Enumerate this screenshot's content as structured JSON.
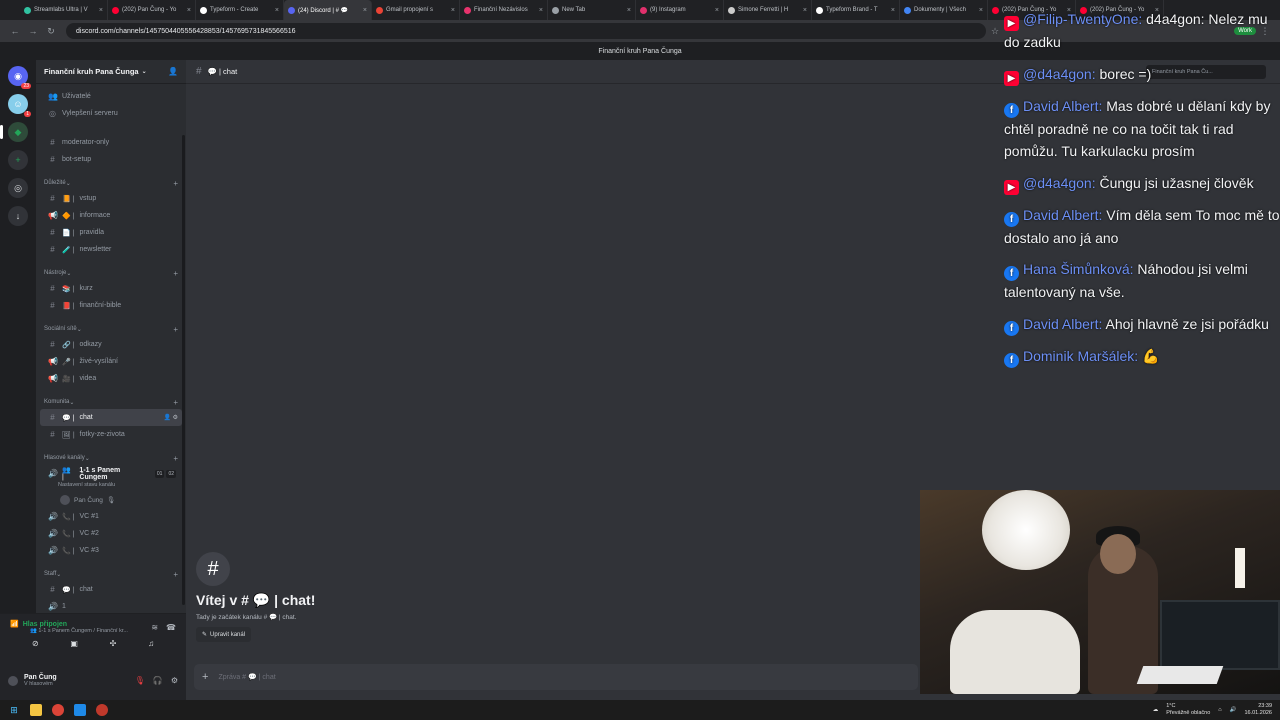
{
  "browser": {
    "tabs": [
      {
        "label": "Streamlabs Ultra | V",
        "color": "#31c3a2"
      },
      {
        "label": "(202) Pan Čung - Yo",
        "color": "#ff0033"
      },
      {
        "label": "Typeform - Create",
        "color": "#ffffff"
      },
      {
        "label": "(24) Discord | # 💬",
        "color": "#5865f2",
        "active": true
      },
      {
        "label": "Gmail propojení s",
        "color": "#ea4335"
      },
      {
        "label": "Finanční Nezávislos",
        "color": "#e8336d"
      },
      {
        "label": "New Tab",
        "color": "#9aa0a6"
      },
      {
        "label": "(9) Instagram",
        "color": "#e1306c"
      },
      {
        "label": "Simone Ferretti | H",
        "color": "#cccccc"
      },
      {
        "label": "Typeform Brand - T",
        "color": "#ffffff"
      },
      {
        "label": "Dokumenty | Všech",
        "color": "#4285f4"
      },
      {
        "label": "(202) Pan Čung - Yo",
        "color": "#ff0033"
      },
      {
        "label": "(202) Pan Čung - Yo",
        "color": "#ff0033"
      }
    ],
    "url": "discord.com/channels/1457504405556428853/1457695731845566516",
    "profile_label": "Work"
  },
  "discord": {
    "window_title": "Finanční kruh Pana Čunga",
    "rail_badges": [
      "23",
      "1"
    ],
    "server_name": "Finanční kruh Pana Čunga",
    "top_items": [
      {
        "icon": "👥",
        "label": "Uživatelé"
      },
      {
        "icon": "◎",
        "label": "Vylepšení serveru"
      }
    ],
    "loose_channels": [
      "moderator-only",
      "bot-setup"
    ],
    "categories": [
      {
        "name": "Důležité",
        "channels": [
          {
            "type": "text",
            "emoji": "📙",
            "label": "vstup"
          },
          {
            "type": "announce",
            "emoji": "🔶",
            "label": "informace"
          },
          {
            "type": "text",
            "emoji": "📄",
            "label": "pravidla"
          },
          {
            "type": "text",
            "emoji": "🧪",
            "label": "newsletter"
          }
        ]
      },
      {
        "name": "Nástroje",
        "channels": [
          {
            "type": "text",
            "emoji": "📚",
            "label": "kurz"
          },
          {
            "type": "text",
            "emoji": "📕",
            "label": "finanční-bible"
          }
        ]
      },
      {
        "name": "Sociální sítě",
        "channels": [
          {
            "type": "text",
            "emoji": "🔗",
            "label": "odkazy"
          },
          {
            "type": "announce",
            "emoji": "🎤",
            "label": "živé-vysílání"
          },
          {
            "type": "announce",
            "emoji": "🎥",
            "label": "videa"
          }
        ]
      },
      {
        "name": "Komunita",
        "channels": [
          {
            "type": "text",
            "emoji": "💬",
            "label": "chat",
            "selected": true
          },
          {
            "type": "text",
            "emoji": "🖼",
            "label": "fotky-ze-zivota"
          }
        ]
      }
    ],
    "voice_category": "Hlasové kanály",
    "voice_main": {
      "emoji": "👥",
      "label": "1-1 s Panem Čungem",
      "counts": [
        "01",
        "02"
      ],
      "status": "Nastavení stavu kanálu",
      "member": "Pan Čung"
    },
    "voice_channels": [
      "VC #1",
      "VC #2",
      "VC #3"
    ],
    "staff_category": "Staff",
    "staff_channels": [
      {
        "type": "text",
        "emoji": "💬",
        "label": "chat"
      },
      {
        "type": "voice",
        "emoji": "",
        "label": "1"
      }
    ],
    "voice_panel": {
      "status": "Hlas připojen",
      "sub": "👥 1-1 s Panem Čungem / Finanční kr..."
    },
    "user": {
      "name": "Pan Čung",
      "status": "V hlasovém"
    },
    "channel_header": "💬 | chat",
    "header_search": "Finanční kruh Pana Ču...",
    "welcome_title": "Vítej v # 💬 | chat!",
    "welcome_sub": "Tady je začátek kanálu # 💬 | chat.",
    "edit_channel": "Upravit kanál",
    "composer_placeholder": "Zpráva # 💬 | chat"
  },
  "overlay_chat": [
    {
      "platform": "youtube",
      "author": "@Filip-TwentyOne:",
      "text": "d4a4gon: Nelez mu do zadku"
    },
    {
      "platform": "youtube",
      "author": "@d4a4gon:",
      "text": "borec =)"
    },
    {
      "platform": "facebook",
      "author": "David Albert:",
      "text": "Mas dobré u dělaní kdy by chtěl poradně ne co na točit tak ti rad pomůžu. Tu karkulacku prosím"
    },
    {
      "platform": "youtube",
      "author": "@d4a4gon:",
      "text": "Čungu jsi užasnej člověk"
    },
    {
      "platform": "facebook",
      "author": "David Albert:",
      "text": "Vím děla sem To moc mě to dostalo ano já ano"
    },
    {
      "platform": "facebook",
      "author": "Hana Šimůnková:",
      "text": "Náhodou jsi velmi talentovaný na vše."
    },
    {
      "platform": "facebook",
      "author": "David Albert:",
      "text": "Ahoj hlavně ze jsi pořádku"
    },
    {
      "platform": "facebook",
      "author": "Dominik Maršálek:",
      "text": "💪"
    }
  ],
  "taskbar": {
    "weather_temp": "1°C",
    "weather_desc": "Převážně oblačno",
    "time": "23:39",
    "date": "16.01.2026"
  }
}
